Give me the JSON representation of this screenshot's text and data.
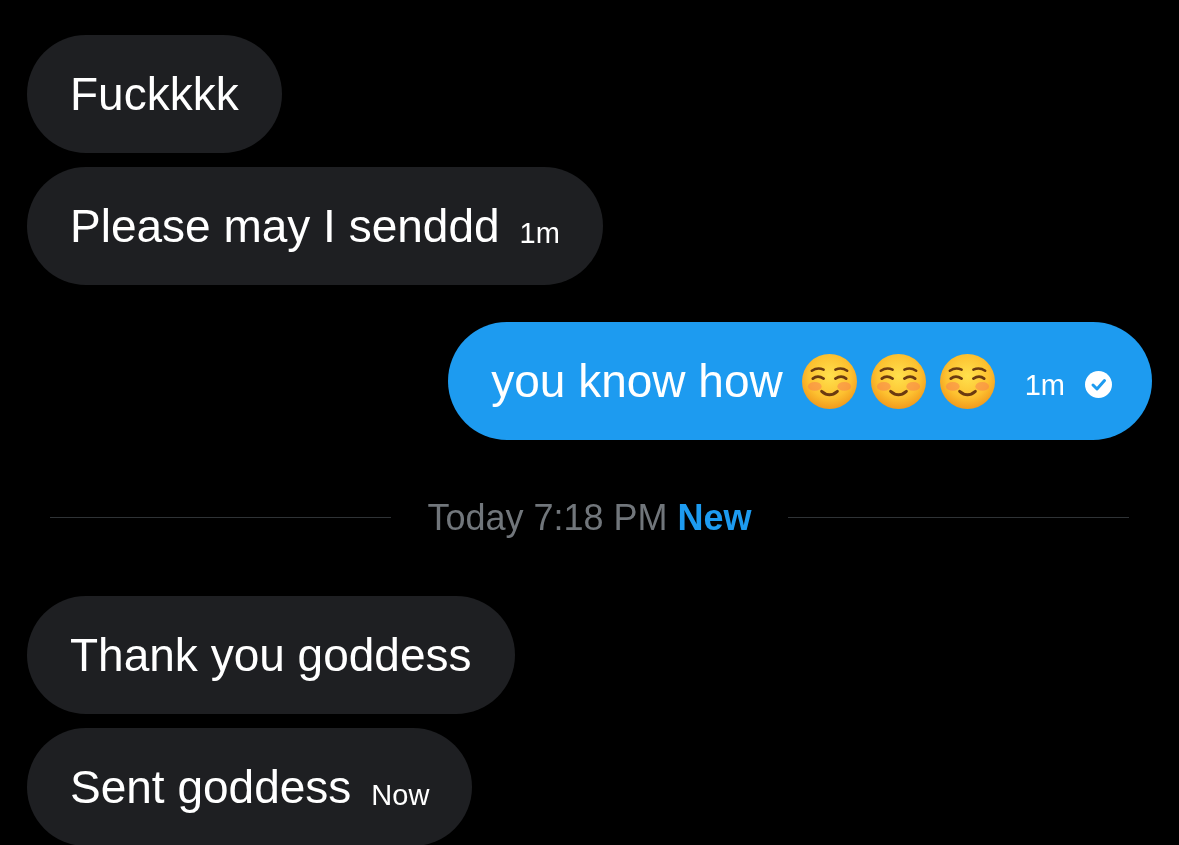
{
  "thread": [
    {
      "kind": "received",
      "text": "Fuckkkk"
    },
    {
      "kind": "received",
      "text": "Please may I senddd",
      "time": "1m"
    },
    {
      "kind": "sent",
      "text": "you know how",
      "emojis": [
        {
          "kind": "smiling-face"
        },
        {
          "kind": "smiling-face"
        },
        {
          "kind": "smiling-face"
        }
      ],
      "time": "1m",
      "seen": true
    },
    {
      "kind": "divider",
      "label": "Today 7:18 PM",
      "badge": "New"
    },
    {
      "kind": "received",
      "text": "Thank you goddess"
    },
    {
      "kind": "received",
      "text": "Sent goddess",
      "time": "Now"
    }
  ]
}
